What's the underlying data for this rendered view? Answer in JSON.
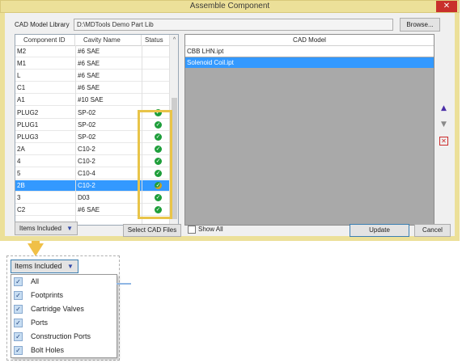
{
  "window": {
    "title": "Assemble Component",
    "close_glyph": "✕"
  },
  "library": {
    "label": "CAD Model Library",
    "value": "D:\\MDTools Demo Part Lib",
    "browse_label": "Browse..."
  },
  "grid": {
    "headers": [
      "Component ID",
      "Cavity Name",
      "Status"
    ],
    "sort_glyph": "^",
    "rows": [
      {
        "id": "M2",
        "cavity": "#6 SAE",
        "status": ""
      },
      {
        "id": "M1",
        "cavity": "#6 SAE",
        "status": ""
      },
      {
        "id": "L",
        "cavity": "#6 SAE",
        "status": ""
      },
      {
        "id": "C1",
        "cavity": "#6 SAE",
        "status": ""
      },
      {
        "id": "A1",
        "cavity": "#10 SAE",
        "status": ""
      },
      {
        "id": "PLUG2",
        "cavity": "SP-02",
        "status": "ok"
      },
      {
        "id": "PLUG1",
        "cavity": "SP-02",
        "status": "ok"
      },
      {
        "id": "PLUG3",
        "cavity": "SP-02",
        "status": "ok"
      },
      {
        "id": "2A",
        "cavity": "C10-2",
        "status": "ok"
      },
      {
        "id": "4",
        "cavity": "C10-2",
        "status": "ok"
      },
      {
        "id": "5",
        "cavity": "C10-4",
        "status": "ok"
      },
      {
        "id": "2B",
        "cavity": "C10-2",
        "status": "ok-partial",
        "selected": true
      },
      {
        "id": "3",
        "cavity": "D03",
        "status": "ok"
      },
      {
        "id": "C2",
        "cavity": "#6 SAE",
        "status": "ok"
      }
    ]
  },
  "cad_model": {
    "header": "CAD Model",
    "items": [
      {
        "label": "CBB LHN.ipt",
        "selected": false
      },
      {
        "label": "Solenoid Coil.ipt",
        "selected": true
      }
    ]
  },
  "side_buttons": {
    "up": "▲",
    "down": "▼",
    "remove": "✕"
  },
  "footer": {
    "filter_label": "Items Included",
    "filter_caret": "▼",
    "select_files_label": "Select CAD Files",
    "show_all_label": "Show All",
    "update_label": "Update",
    "cancel_label": "Cancel"
  },
  "zoom_menu": {
    "button_label": "Items Included",
    "items": [
      {
        "label": "All",
        "checked": true
      },
      {
        "label": "Footprints",
        "checked": true
      },
      {
        "label": "Cartridge Valves",
        "checked": true
      },
      {
        "label": "Ports",
        "checked": true
      },
      {
        "label": "Construction Ports",
        "checked": true
      },
      {
        "label": "Bolt Holes",
        "checked": true
      }
    ]
  },
  "colors": {
    "accent": "#3399ff",
    "highlight": "#e8c449",
    "ok": "#1e9e3a",
    "title_bar": "#ece099"
  }
}
